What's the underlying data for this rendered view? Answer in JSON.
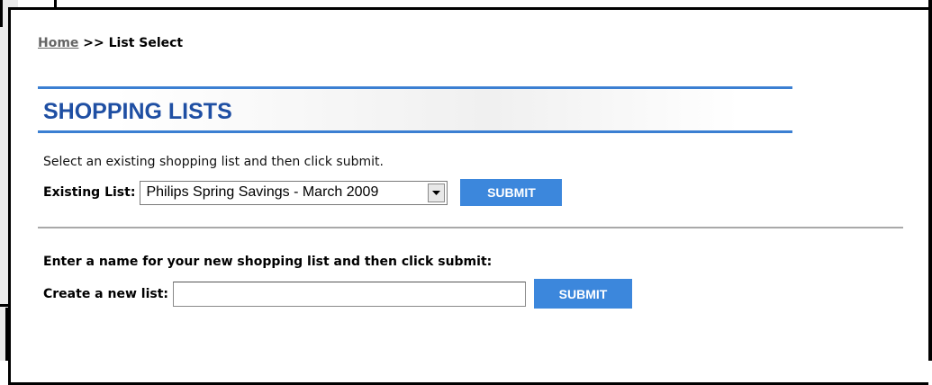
{
  "breadcrumb": {
    "home": "Home",
    "separator": ">>",
    "current": "List Select"
  },
  "section_title": "SHOPPING LISTS",
  "existing": {
    "instruction": "Select an existing shopping list and then click submit.",
    "label": "Existing List:",
    "selected_value": "Philips Spring Savings - March 2009",
    "submit_label": "SUBMIT"
  },
  "create": {
    "instruction": "Enter a name for your new shopping list and then click submit:",
    "label": "Create a new list:",
    "input_value": "",
    "submit_label": "SUBMIT"
  },
  "colors": {
    "accent": "#3c87dc",
    "title": "#1f4fa3",
    "rule": "#3b7fd2"
  },
  "icons": {
    "dropdown": "chevron-down-icon"
  }
}
